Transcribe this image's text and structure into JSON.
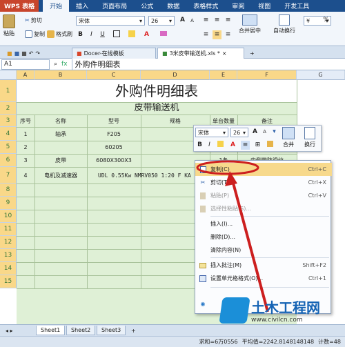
{
  "menu": {
    "app": "WPS 表格",
    "items": [
      "开始",
      "插入",
      "页面布局",
      "公式",
      "数据",
      "表格样式",
      "审阅",
      "视图",
      "开发工具"
    ]
  },
  "ribbon": {
    "cut": "剪切",
    "paste": "粘贴",
    "copy": "复制",
    "format_painter": "格式刷",
    "font": "宋体",
    "size": "26",
    "merge": "合并居中",
    "wrap": "自动换行",
    "percent": "%"
  },
  "tabs": [
    {
      "label": "Docer-在线模板"
    },
    {
      "label": "3米皮带输送机.xls *"
    }
  ],
  "formula": {
    "namebox": "A1",
    "fx": "fx",
    "content": "外购件明细表"
  },
  "columns": [
    "A",
    "B",
    "C",
    "D",
    "E",
    "F",
    "G"
  ],
  "rows": [
    "1",
    "2",
    "3",
    "4",
    "5",
    "6",
    "7",
    "8",
    "9",
    "10",
    "11",
    "12",
    "13",
    "14",
    "15"
  ],
  "sheet": {
    "title": "外购件明细表",
    "subtitle": "皮带输送机",
    "headers": [
      "序号",
      "名称",
      "型号",
      "规格",
      "单台数量",
      "备注"
    ],
    "r4": [
      "1",
      "轴承",
      "F205"
    ],
    "r5": [
      "2",
      "60205"
    ],
    "r6": [
      "3",
      "皮带",
      "6080X300X3",
      "1条",
      "内侧带防滑纹"
    ],
    "r7": [
      "4",
      "电机及减速器",
      "UDL 0.55Kw NMRV050 1:20 F KA"
    ]
  },
  "mini_toolbar": {
    "font": "宋体",
    "size": "26",
    "merge": "合并",
    "wrap": "换行",
    "bold": "B",
    "italic": "I"
  },
  "context_menu": [
    {
      "label": "复制(C)",
      "shortcut": "Ctrl+C",
      "disabled": false
    },
    {
      "label": "剪切(T)",
      "shortcut": "Ctrl+X",
      "disabled": false
    },
    {
      "label": "粘贴(P)",
      "shortcut": "Ctrl+V",
      "disabled": true
    },
    {
      "label": "选择性粘贴(S)...",
      "shortcut": "",
      "disabled": true
    },
    {
      "label": "插入(I)...",
      "shortcut": "",
      "disabled": false
    },
    {
      "label": "删除(D)...",
      "shortcut": "",
      "disabled": false
    },
    {
      "label": "清除内容(N)",
      "shortcut": "",
      "disabled": false
    },
    {
      "label": "插入批注(M)",
      "shortcut": "Shift+F2",
      "disabled": false
    },
    {
      "label": "设置单元格格式(O)...",
      "shortcut": "Ctrl+1",
      "disabled": false
    }
  ],
  "sheet_tabs": [
    "Sheet1",
    "Sheet2",
    "Sheet3"
  ],
  "status": {
    "sum": "求和=6万0556",
    "avg": "平均值=2242.8148148148",
    "count": "计数=48"
  },
  "watermark": {
    "name": "土木工程网",
    "url": "www.civilcn.com"
  },
  "colors": {
    "menubar": "#1c4f8d",
    "table_fill": "#dff0d6",
    "highlight": "#cc1f1f"
  }
}
